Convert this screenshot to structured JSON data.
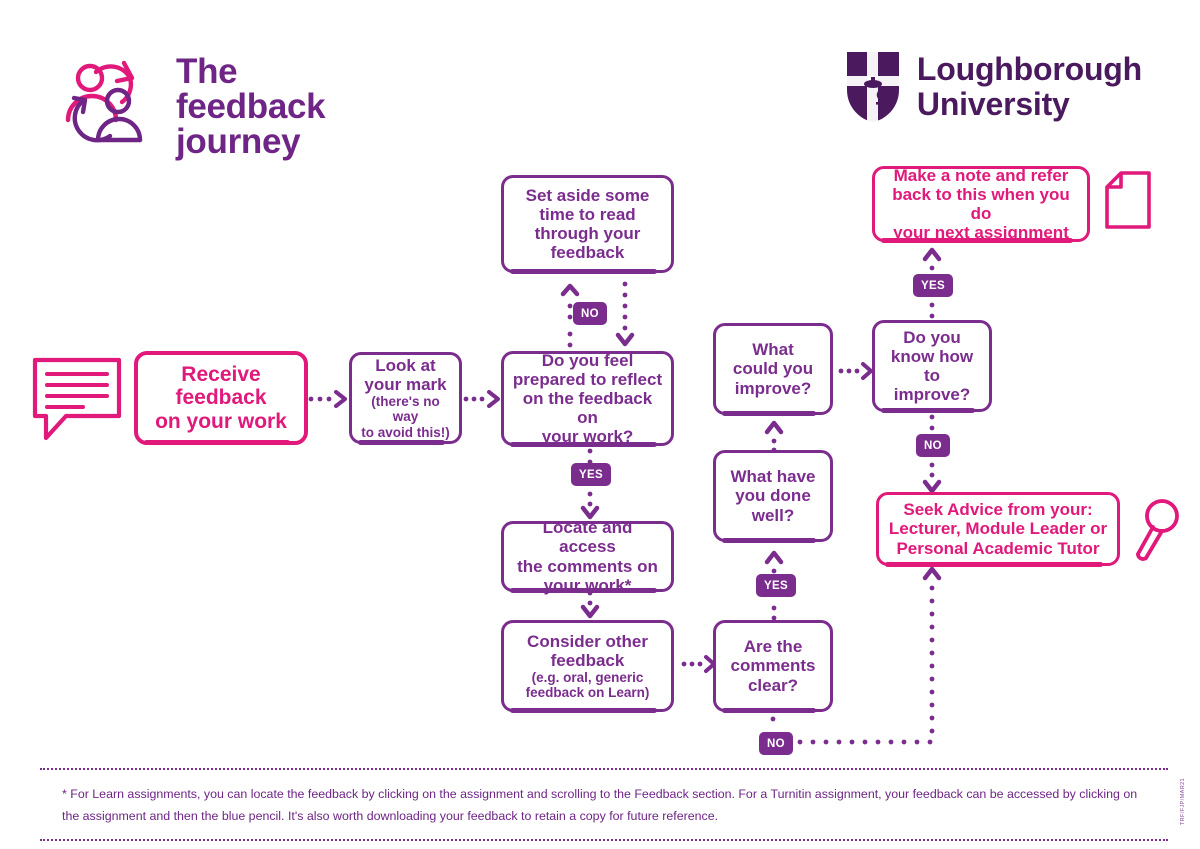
{
  "brand": {
    "title_lines": [
      "The",
      "feedback",
      "journey"
    ],
    "title_full": "The feedback journey",
    "logo_icon": "feedback-journey-people-cycle-icon",
    "university_lines": [
      "Loughborough",
      "University"
    ],
    "university_full": "Loughborough University",
    "crest_icon": "loughborough-shield-crest-icon"
  },
  "colors": {
    "purple": "#7B2D8E",
    "purple_dark": "#6E2585",
    "pink": "#E0197B",
    "white": "#FFFFFF"
  },
  "nodes": {
    "receive": {
      "line1": "Receive",
      "line2": "feedback",
      "line3": "on your work"
    },
    "look_mark": {
      "main1": "Look at",
      "main2": "your mark",
      "sub1": "(there's no way",
      "sub2": "to avoid this!)"
    },
    "set_aside": {
      "line1": "Set aside some",
      "line2": "time to read",
      "line3": "through your",
      "line4": "feedback"
    },
    "prepared": {
      "line1": "Do you feel",
      "line2": "prepared to reflect",
      "line3": "on the feedback on",
      "line4": "your work?"
    },
    "locate": {
      "line1": "Locate and access",
      "line2": "the comments on",
      "line3": "your work*"
    },
    "consider": {
      "main1": "Consider other",
      "main2": "feedback",
      "sub1": "(e.g. oral, generic",
      "sub2": "feedback on Learn)"
    },
    "improve_q": {
      "line1": "What",
      "line2": "could you",
      "line3": "improve?"
    },
    "done_well": {
      "line1": "What have",
      "line2": "you done",
      "line3": "well?"
    },
    "comments_clear": {
      "line1": "Are the",
      "line2": "comments",
      "line3": "clear?"
    },
    "know_how": {
      "line1": "Do you",
      "line2": "know how to",
      "line3": "improve?"
    },
    "make_note": {
      "line1": "Make a note and refer",
      "line2": "back to this when you do",
      "line3": "your next assignment"
    },
    "seek_advice": {
      "line1": "Seek Advice from your:",
      "line2": "Lecturer, Module Leader or",
      "line3": "Personal Academic Tutor"
    }
  },
  "badges": {
    "no_prepared": "NO",
    "yes_prepared": "YES",
    "yes_comments_clear": "YES",
    "no_comments_clear": "NO",
    "yes_know_how": "YES",
    "no_know_how": "NO"
  },
  "icons": {
    "speech_bubble": "speech-bubble-icon",
    "document": "document-page-icon",
    "magnifier": "magnifying-glass-icon"
  },
  "footnote": {
    "text": "* For Learn assignments, you can locate the feedback by clicking on the assignment and scrolling to the Feedback section. For a Turnitin assignment, your feedback can be accessed by clicking on the assignment and then the blue pencil. It's also worth downloading your feedback to retain a copy for future reference."
  },
  "side_code": {
    "text": "TRF/FJP/MAR21"
  }
}
